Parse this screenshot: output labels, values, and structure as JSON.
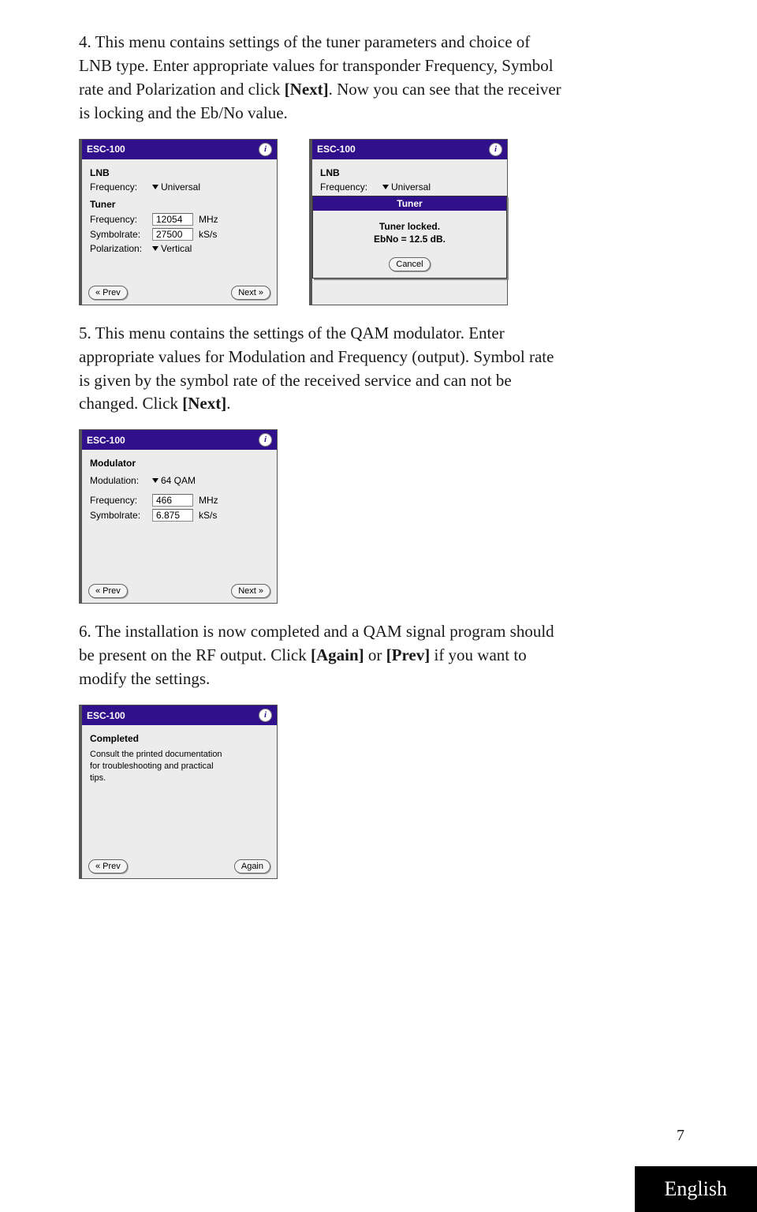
{
  "para4_l1": "4. This menu contains settings of the tuner parameters and choice of",
  "para4_l2": "LNB type. Enter appropriate values for transponder Frequency, Symbol",
  "para4_l3_a": "rate and Polarization and click ",
  "para4_l3_b": "[Next]",
  "para4_l3_c": ". Now you can see that the receiver",
  "para4_l4": "is locking and the Eb/No value.",
  "p1": {
    "title": "ESC-100",
    "lnb": "LNB",
    "freq_k": "Frequency:",
    "freq_v": "Universal",
    "tuner": "Tuner",
    "tf_k": "Frequency:",
    "tf_v": "12054",
    "tf_u": "MHz",
    "sr_k": "Symbolrate:",
    "sr_v": "27500",
    "sr_u": "kS/s",
    "pol_k": "Polarization:",
    "pol_v": "Vertical",
    "prev": "« Prev",
    "next": "Next »"
  },
  "p2": {
    "title": "ESC-100",
    "lnb": "LNB",
    "freq_k": "Frequency:",
    "freq_v": "Universal",
    "tuner": "Tuner",
    "m_title": "Tuner",
    "m_l1": "Tuner locked.",
    "m_l2": "EbNo = 12.5 dB.",
    "cancel": "Cancel"
  },
  "para5_l1": "5. This menu contains the settings of the QAM modulator. Enter",
  "para5_l2": "appropriate values for Modulation and  Frequency (output). Symbol rate",
  "para5_l3": "is given by the symbol rate of the received service and can not be",
  "para5_l4_a": "changed. Click ",
  "para5_l4_b": "[Next]",
  "para5_l4_c": ".",
  "p3": {
    "title": "ESC-100",
    "mod": "Modulator",
    "mk": "Modulation:",
    "mv": "64 QAM",
    "fk": "Frequency:",
    "fv": "466",
    "fu": "MHz",
    "sk": "Symbolrate:",
    "sv": "6.875",
    "su": "kS/s",
    "prev": "« Prev",
    "next": "Next »"
  },
  "para6_l1": "6. The installation is now completed and a QAM signal program should",
  "para6_l2_a": "be present on the RF output. Click ",
  "para6_l2_b": "[Again]",
  "para6_l2_c": " or ",
  "para6_l2_d": "[Prev]",
  "para6_l2_e": " if you want to",
  "para6_l3": "modify the settings.",
  "p4": {
    "title": "ESC-100",
    "comp": "Completed",
    "t1": "Consult the printed documentation",
    "t2": "for troubleshooting and practical",
    "t3": "tips.",
    "prev": "« Prev",
    "again": "Again"
  },
  "pagenum": "7",
  "lang": "English"
}
